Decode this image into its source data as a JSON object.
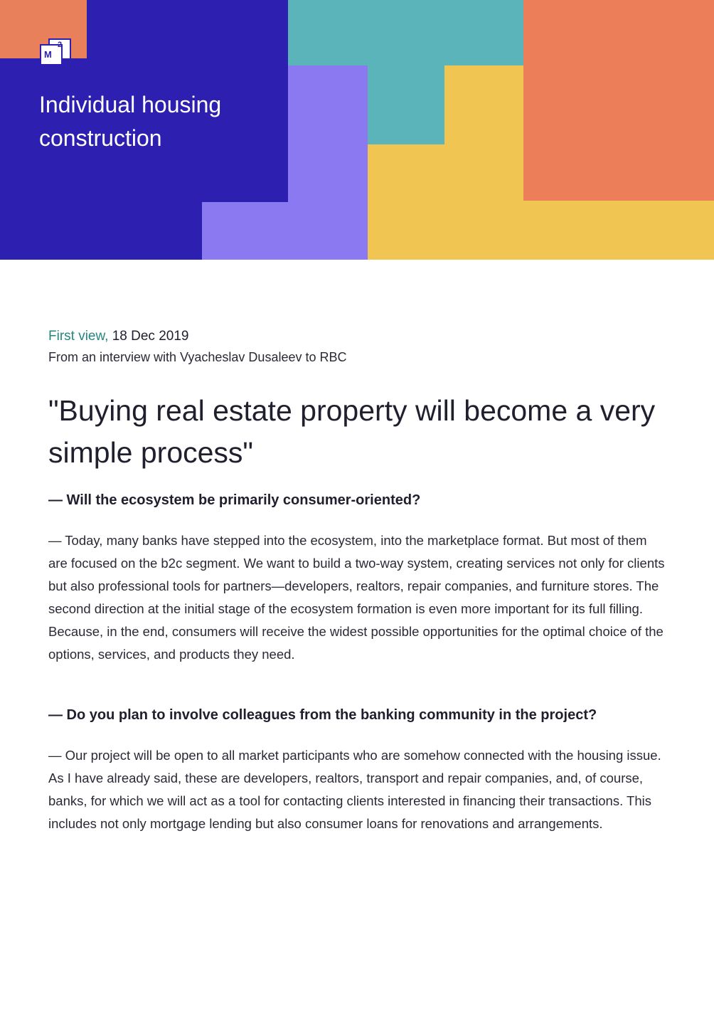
{
  "header": {
    "logo": {
      "letter": "M",
      "superscript": "2"
    },
    "title": "Individual housing construction",
    "colors": {
      "navy": "#2d1fb0",
      "orange": "#ec7e5a",
      "teal": "#5ab4b9",
      "lavender": "#8b79f2",
      "yellow": "#f0c552"
    }
  },
  "meta": {
    "source": "First view,",
    "date": "18 Dec 2019",
    "subtitle": "From an interview with Vyacheslav Dusaleev to RBC"
  },
  "article": {
    "headline": "\"Buying real estate property will become a very simple process\"",
    "q1": "— Will the ecosystem be primarily consumer-oriented?",
    "a1": "— Today, many banks have stepped into the ecosystem, into the marketplace format. But most of them are focused on the b2c segment. We want to build a two-way system, creating services not only for clients but also professional tools for partners—developers, realtors, repair companies, and furniture stores. The second direction at the initial stage of the ecosystem formation is even more important for its full filling. Because, in the end, consumers will receive the widest possible opportunities for the optimal choice of the options, services, and products they need.",
    "q2": "— Do you plan to involve colleagues from the banking community in the project?",
    "a2": "— Our project will be open to all market participants who are somehow connected with the housing issue. As I have already said, these are developers, realtors, transport and repair companies, and, of course, banks, for which we will act as a tool for contacting clients interested in financing their transactions. This includes not only mortgage lending but also consumer loans for renovations and arrangements."
  }
}
